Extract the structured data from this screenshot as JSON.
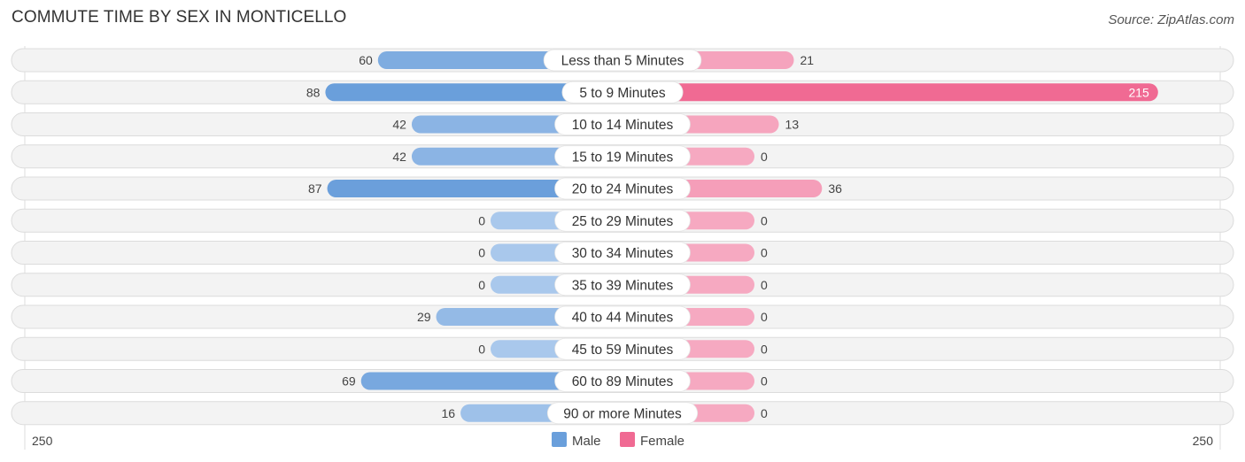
{
  "title": "COMMUTE TIME BY SEX IN MONTICELLO",
  "source": "Source: ZipAtlas.com",
  "colors": {
    "male_strong": "#6a9fdb",
    "male_light": "#a9c8ec",
    "female_strong": "#f06a93",
    "female_light": "#f6a9c1"
  },
  "chart_data": {
    "type": "bar",
    "orientation": "horizontal-diverging",
    "title": "COMMUTE TIME BY SEX IN MONTICELLO",
    "categories": [
      "Less than 5 Minutes",
      "5 to 9 Minutes",
      "10 to 14 Minutes",
      "15 to 19 Minutes",
      "20 to 24 Minutes",
      "25 to 29 Minutes",
      "30 to 34 Minutes",
      "35 to 39 Minutes",
      "40 to 44 Minutes",
      "45 to 59 Minutes",
      "60 to 89 Minutes",
      "90 or more Minutes"
    ],
    "series": [
      {
        "name": "Male",
        "side": "left",
        "values": [
          60,
          88,
          42,
          42,
          87,
          0,
          0,
          0,
          29,
          0,
          69,
          16
        ]
      },
      {
        "name": "Female",
        "side": "right",
        "values": [
          21,
          215,
          13,
          0,
          36,
          0,
          0,
          0,
          0,
          0,
          0,
          0
        ]
      }
    ],
    "axis": {
      "left_max_label": "250",
      "right_max_label": "250",
      "range": [
        0,
        250
      ]
    },
    "legend": {
      "items": [
        "Male",
        "Female"
      ],
      "position": "bottom-center"
    },
    "grid": false
  }
}
